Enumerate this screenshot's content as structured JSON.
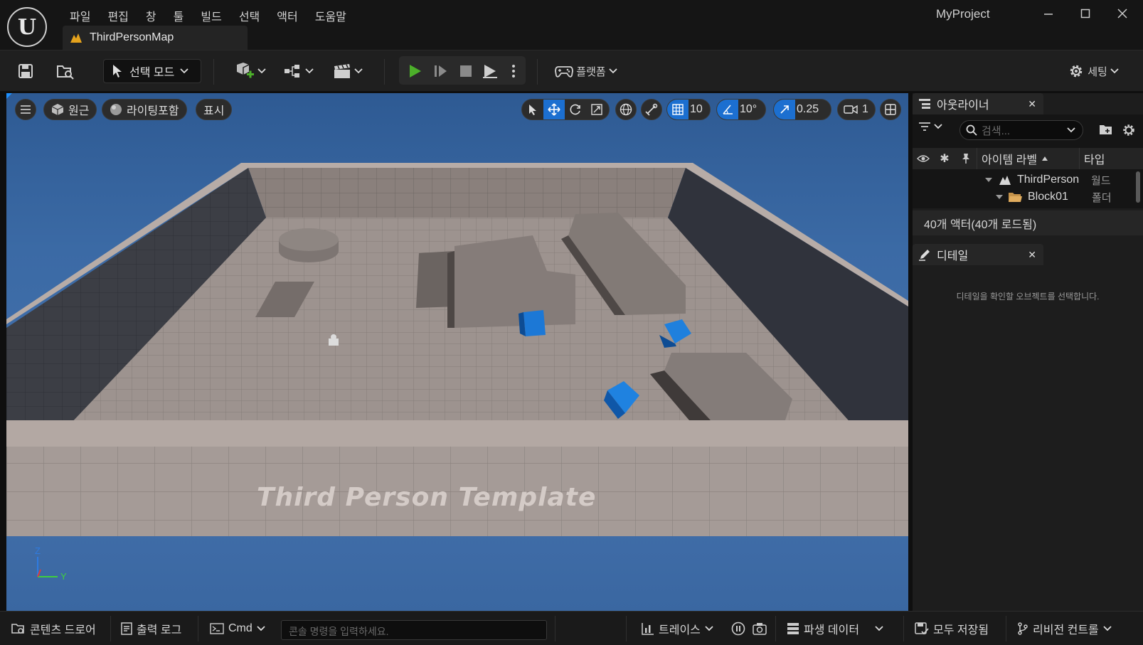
{
  "app": {
    "project_name": "MyProject",
    "map_tab": "ThirdPersonMap",
    "menu": [
      "파일",
      "편집",
      "창",
      "툴",
      "빌드",
      "선택",
      "액터",
      "도움말"
    ]
  },
  "toolbar": {
    "mode_label": "선택 모드",
    "platform_label": "플랫폼",
    "settings_label": "세팅"
  },
  "viewport": {
    "view_mode": "원근",
    "lighting_mode": "라이팅포함",
    "show_label": "표시",
    "grid_snap": "10",
    "rotation_snap": "10°",
    "scale_snap": "0.25",
    "camera_speed": "1",
    "floor_text": "Third Person Template",
    "axis_z": "Z",
    "axis_y": "Y"
  },
  "outliner": {
    "tab_label": "아웃라이너",
    "search_placeholder": "검색...",
    "col_label": "아이템 라벨",
    "col_type": "타입",
    "rows": [
      {
        "label": "ThirdPerson",
        "type": "월드"
      },
      {
        "label": "Block01",
        "type": "폴더"
      }
    ],
    "actor_count": "40개 액터(40개 로드됨)"
  },
  "details": {
    "tab_label": "디테일",
    "empty_message": "디테일을 확인할 오브젝트를 선택합니다."
  },
  "statusbar": {
    "content_drawer": "콘텐츠 드로어",
    "output_log": "출력 로그",
    "cmd_label": "Cmd",
    "console_placeholder": "콘솔 명령을 입력하세요.",
    "trace_label": "트레이스",
    "derived_data": "파생 데이터",
    "save_all": "모두 저장됨",
    "revision_control": "리비전 컨트롤"
  },
  "colors": {
    "accent_blue": "#1c6fd0",
    "play_green": "#4caf2a",
    "sky_blue": "#3b6aa5",
    "map_icon_orange": "#e5a31d"
  }
}
